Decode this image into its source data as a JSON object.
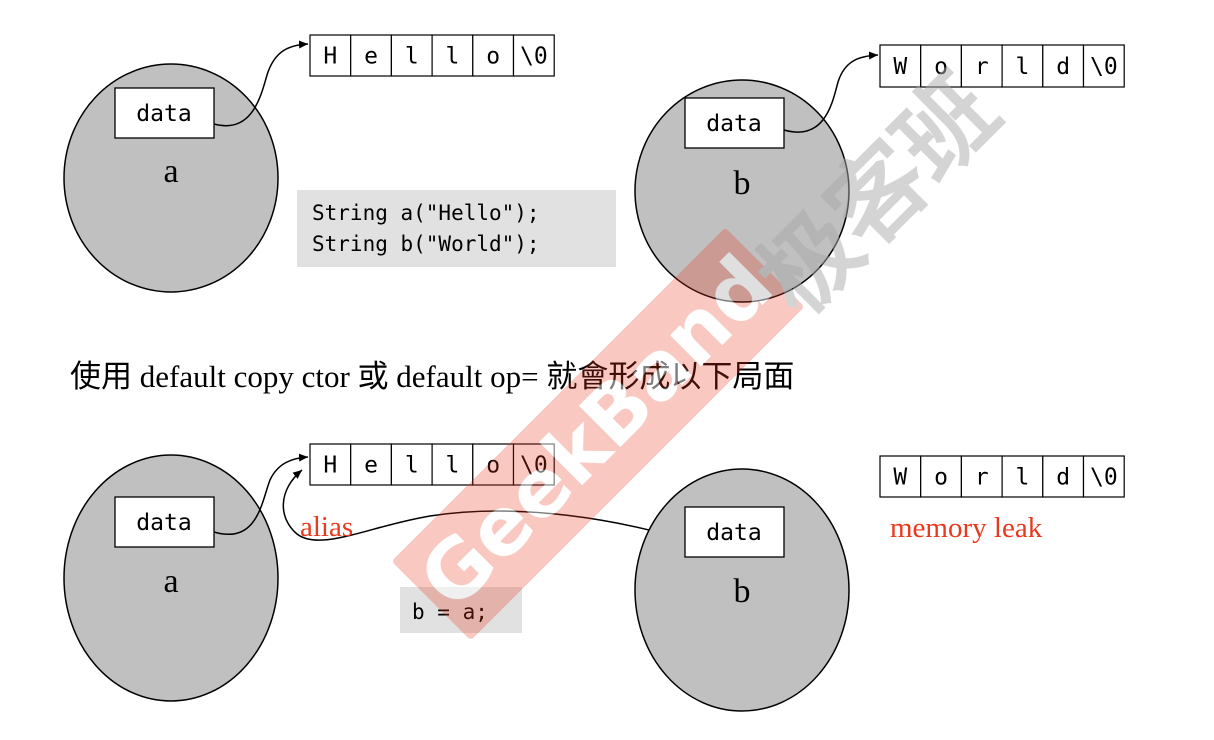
{
  "top": {
    "object_a": {
      "field_label": "data",
      "name": "a"
    },
    "object_b": {
      "field_label": "data",
      "name": "b"
    },
    "string_hello": [
      "H",
      "e",
      "l",
      "l",
      "o",
      "\\0"
    ],
    "string_world": [
      "W",
      "o",
      "r",
      "l",
      "d",
      "\\0"
    ],
    "code_lines": [
      "String a(\"Hello\");",
      "String b(\"World\");"
    ]
  },
  "caption": "使用 default copy ctor 或 default op= 就會形成以下局面",
  "bottom": {
    "object_a": {
      "field_label": "data",
      "name": "a"
    },
    "object_b": {
      "field_label": "data",
      "name": "b"
    },
    "string_hello": [
      "H",
      "e",
      "l",
      "l",
      "o",
      "\\0"
    ],
    "string_world": [
      "W",
      "o",
      "r",
      "l",
      "d",
      "\\0"
    ],
    "alias_label": "alias",
    "memory_leak_label": "memory leak",
    "code": "b = a;"
  },
  "watermark": {
    "brand": "GeekBand",
    "chinese": "极客班"
  },
  "colors": {
    "ellipse_fill": "#c0c0c0",
    "code_bg": "#e1e1e1",
    "highlight_red": "#e8391f",
    "watermark_red": "#f2c0b6",
    "watermark_gray": "#cfcfcf"
  }
}
